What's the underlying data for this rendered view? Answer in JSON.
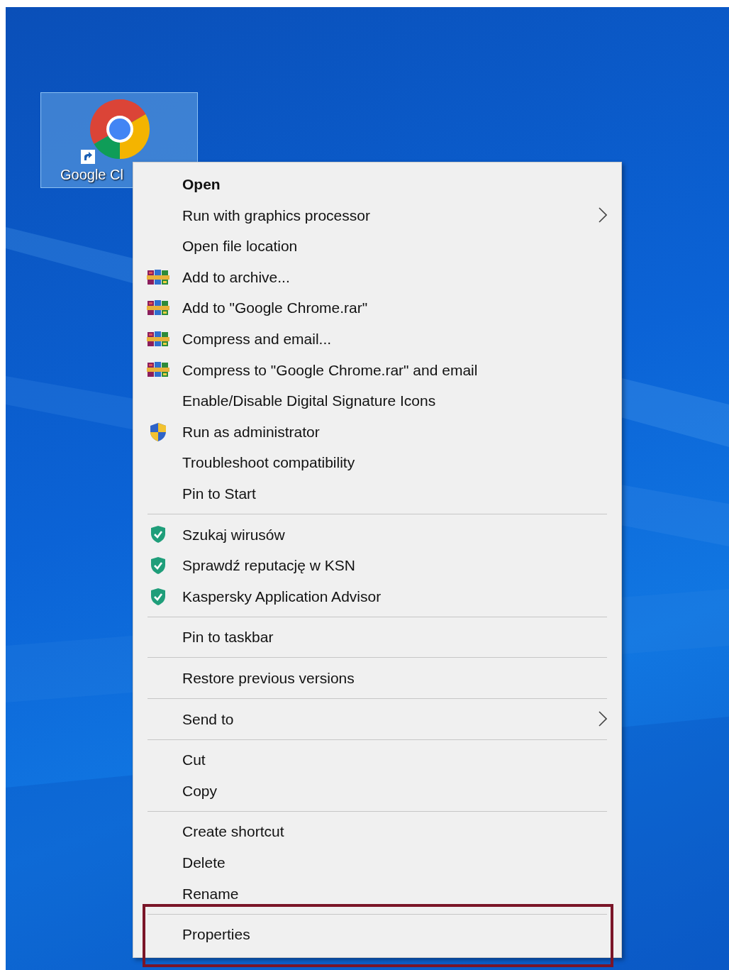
{
  "desktop_icon": {
    "label": "Google Cl",
    "selected": true
  },
  "context_menu": {
    "groups": [
      [
        {
          "label": "Open",
          "kind": "plain",
          "default": true,
          "submenu": false,
          "highlighted": false
        },
        {
          "label": "Run with graphics processor",
          "kind": "plain",
          "default": false,
          "submenu": true,
          "highlighted": false
        },
        {
          "label": "Open file location",
          "kind": "plain",
          "default": false,
          "submenu": false,
          "highlighted": false
        },
        {
          "label": "Add to archive...",
          "kind": "archive",
          "default": false,
          "submenu": false,
          "highlighted": false
        },
        {
          "label": "Add to \"Google Chrome.rar\"",
          "kind": "archive",
          "default": false,
          "submenu": false,
          "highlighted": false
        },
        {
          "label": "Compress and email...",
          "kind": "archive",
          "default": false,
          "submenu": false,
          "highlighted": false
        },
        {
          "label": "Compress to \"Google Chrome.rar\" and email",
          "kind": "archive",
          "default": false,
          "submenu": false,
          "highlighted": false
        },
        {
          "label": "Enable/Disable Digital Signature Icons",
          "kind": "plain",
          "default": false,
          "submenu": false,
          "highlighted": false
        },
        {
          "label": "Run as administrator",
          "kind": "admin",
          "default": false,
          "submenu": false,
          "highlighted": false
        },
        {
          "label": "Troubleshoot compatibility",
          "kind": "plain",
          "default": false,
          "submenu": false,
          "highlighted": false
        },
        {
          "label": "Pin to Start",
          "kind": "plain",
          "default": false,
          "submenu": false,
          "highlighted": false
        }
      ],
      [
        {
          "label": "Szukaj wirusów",
          "kind": "antivirus",
          "default": false,
          "submenu": false,
          "highlighted": false
        },
        {
          "label": "Sprawdź reputację w KSN",
          "kind": "antivirus",
          "default": false,
          "submenu": false,
          "highlighted": false
        },
        {
          "label": "Kaspersky Application Advisor",
          "kind": "antivirus",
          "default": false,
          "submenu": false,
          "highlighted": false
        }
      ],
      [
        {
          "label": "Pin to taskbar",
          "kind": "plain",
          "default": false,
          "submenu": false,
          "highlighted": false
        }
      ],
      [
        {
          "label": "Restore previous versions",
          "kind": "plain",
          "default": false,
          "submenu": false,
          "highlighted": false
        }
      ],
      [
        {
          "label": "Send to",
          "kind": "plain",
          "default": false,
          "submenu": true,
          "highlighted": false
        }
      ],
      [
        {
          "label": "Cut",
          "kind": "plain",
          "default": false,
          "submenu": false,
          "highlighted": false
        },
        {
          "label": "Copy",
          "kind": "plain",
          "default": false,
          "submenu": false,
          "highlighted": false
        }
      ],
      [
        {
          "label": "Create shortcut",
          "kind": "plain",
          "default": false,
          "submenu": false,
          "highlighted": false
        },
        {
          "label": "Delete",
          "kind": "plain",
          "default": false,
          "submenu": false,
          "highlighted": false
        },
        {
          "label": "Rename",
          "kind": "plain",
          "default": false,
          "submenu": false,
          "highlighted": false
        }
      ],
      [
        {
          "label": "Properties",
          "kind": "plain",
          "default": false,
          "submenu": false,
          "highlighted": true
        }
      ]
    ]
  }
}
